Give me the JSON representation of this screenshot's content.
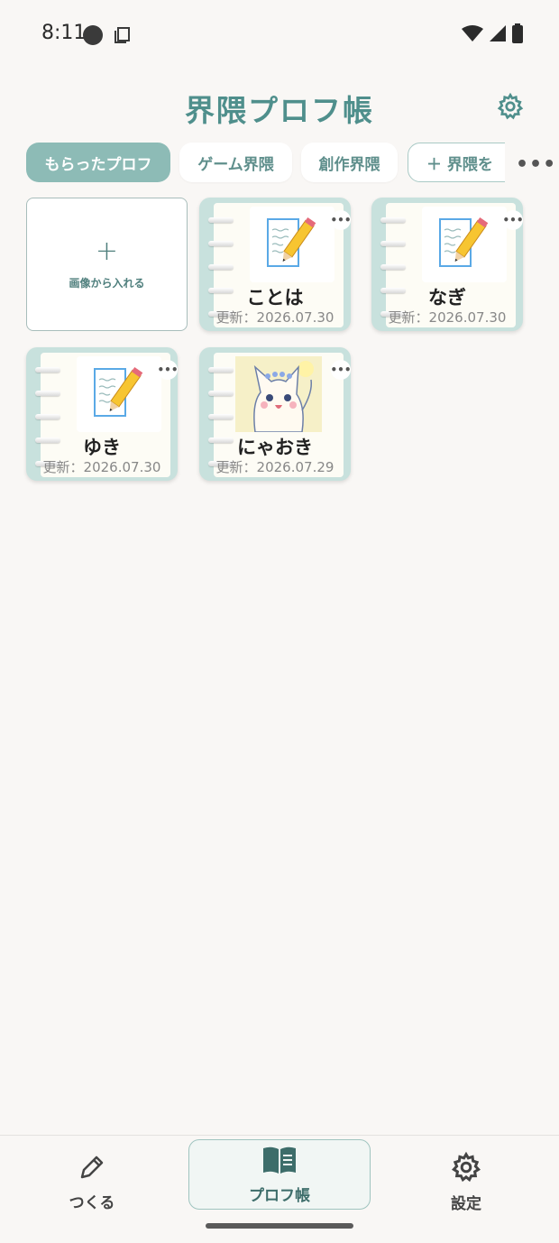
{
  "status": {
    "time": "8:11"
  },
  "header": {
    "title": "界隈プロフ帳"
  },
  "tabs": [
    {
      "label": "もらったプロフ",
      "active": true
    },
    {
      "label": "ゲーム界隈",
      "active": false
    },
    {
      "label": "創作界隈",
      "active": false
    },
    {
      "label": "＋ 界隈を",
      "active": false
    }
  ],
  "more_label": "•••",
  "import_card": {
    "plus": "+",
    "label": "画像から入れる"
  },
  "cards": [
    {
      "name": "ことは",
      "date": "更新：2026.07.30",
      "thumbnail": "memo-pencil-icon"
    },
    {
      "name": "なぎ",
      "date": "更新：2026.07.30",
      "thumbnail": "memo-pencil-icon"
    },
    {
      "name": "ゆき",
      "date": "更新：2026.07.30",
      "thumbnail": "memo-pencil-icon"
    },
    {
      "name": "にゃおき",
      "date": "更新：2026.07.29",
      "thumbnail": "cat-illustration"
    }
  ],
  "card_menu_label": "•••",
  "bottom_nav": [
    {
      "label": "つくる",
      "icon": "pencil-icon",
      "active": false
    },
    {
      "label": "プロフ帳",
      "icon": "book-icon",
      "active": true
    },
    {
      "label": "設定",
      "icon": "gear-icon",
      "active": false
    }
  ],
  "colors": {
    "accent": "#4f8f8c",
    "active_tab": "#8dbbb6",
    "card_bg": "#c8e1dd",
    "background": "#f9f7f5"
  }
}
